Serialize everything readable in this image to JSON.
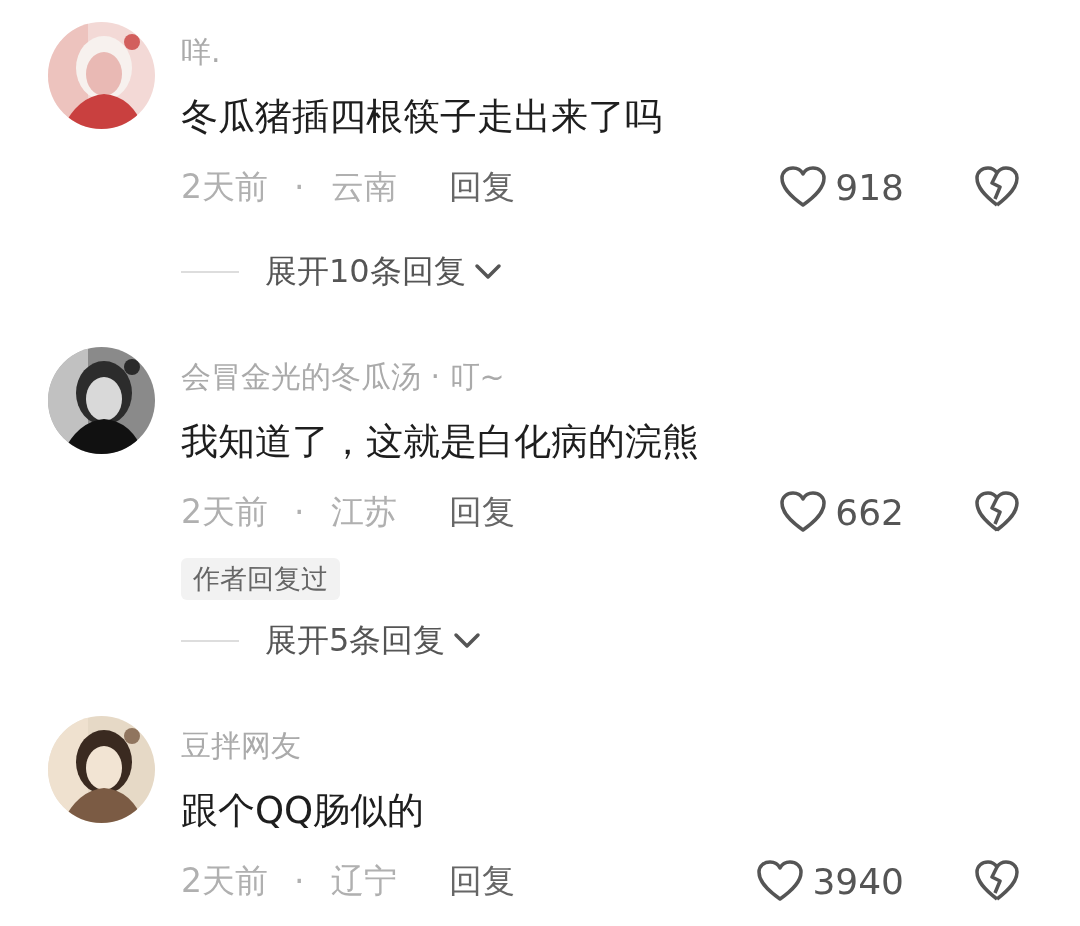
{
  "comments": [
    {
      "name": "咩.",
      "text": "冬瓜猪插四根筷子走出来了吗",
      "time": "2天前",
      "separator": "·",
      "location": "云南",
      "reply": "回复",
      "likes": "918",
      "expand": "展开10条回复"
    },
    {
      "name": "会冒金光的冬瓜汤 · 叮~",
      "text": "我知道了，这就是白化病的浣熊",
      "time": "2天前",
      "separator": "·",
      "location": "江苏",
      "reply": "回复",
      "likes": "662",
      "tag": "作者回复过",
      "expand": "展开5条回复"
    },
    {
      "name": "豆拌网友",
      "text": "跟个QQ肠似的",
      "time": "2天前",
      "separator": "·",
      "location": "辽宁",
      "reply": "回复",
      "likes": "3940"
    }
  ]
}
